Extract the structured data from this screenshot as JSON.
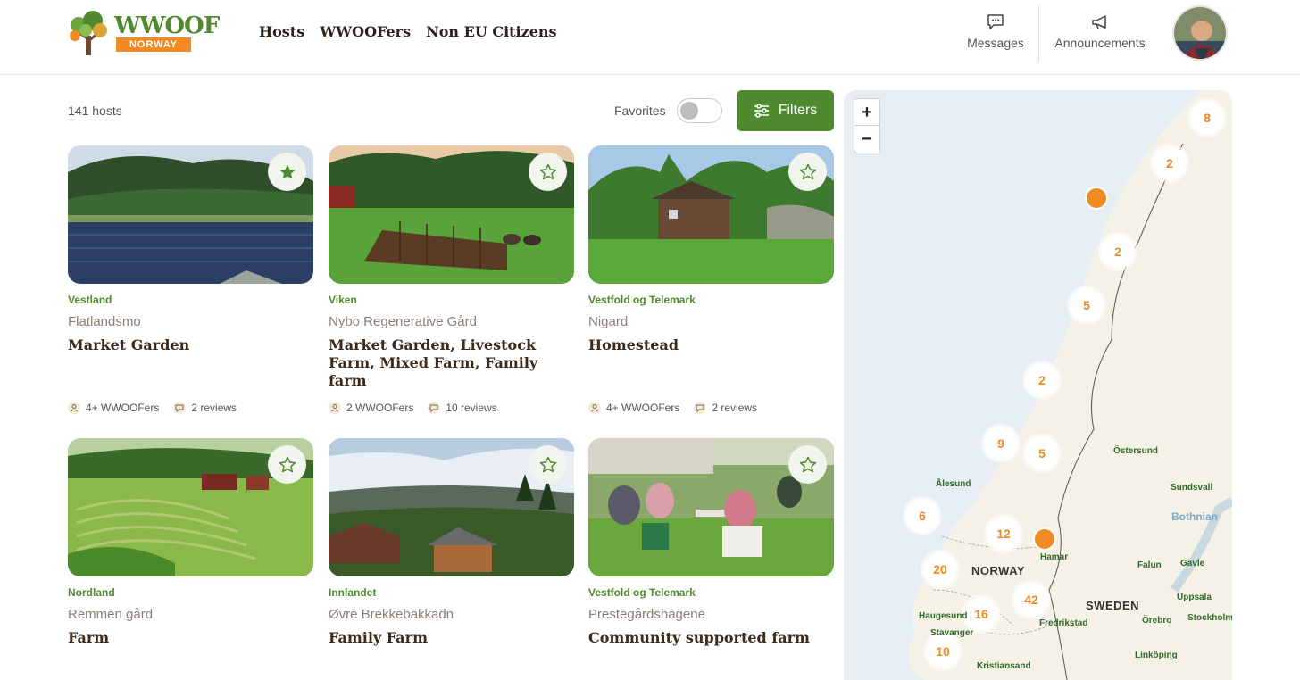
{
  "header": {
    "logo_word": "WWOOF",
    "logo_sub": "NORWAY",
    "nav": [
      "Hosts",
      "WWOOFers",
      "Non EU Citizens"
    ],
    "messages_label": "Messages",
    "announcements_label": "Announcements"
  },
  "toolbar": {
    "hosts_count": "141 hosts",
    "favorites_label": "Favorites",
    "favorites_enabled": false,
    "filters_label": "Filters"
  },
  "cards": [
    {
      "region": "Vestland",
      "name": "Flatlandsmo",
      "type": "Market Garden",
      "wwoofers": "4+ WWOOFers",
      "reviews": "2 reviews",
      "favorited": true
    },
    {
      "region": "Viken",
      "name": "Nybo Regenerative Gård",
      "type": "Market Garden, Livestock Farm, Mixed Farm, Family farm",
      "wwoofers": "2 WWOOFers",
      "reviews": "10 reviews",
      "favorited": false
    },
    {
      "region": "Vestfold og Telemark",
      "name": "Nigard",
      "type": "Homestead",
      "wwoofers": "4+ WWOOFers",
      "reviews": "2 reviews",
      "favorited": false
    },
    {
      "region": "Nordland",
      "name": "Remmen gård",
      "type": "Farm",
      "favorited": false
    },
    {
      "region": "Innlandet",
      "name": "Øvre Brekkebakkadn",
      "type": "Family Farm",
      "favorited": false
    },
    {
      "region": "Vestfold og Telemark",
      "name": "Prestegårdshagene",
      "type": "Community supported farm",
      "favorited": false
    }
  ],
  "map": {
    "zoom_in": "+",
    "zoom_out": "−",
    "clusters": [
      "8",
      "2",
      "2",
      "5",
      "2",
      "9",
      "5",
      "6",
      "12",
      "20",
      "42",
      "16",
      "10"
    ],
    "cities": [
      "Östersund",
      "Sundsvall",
      "Ålesund",
      "Hamar",
      "Falun",
      "Gävle",
      "Uppsala",
      "Haugesund",
      "Fredrikstad",
      "Örebro",
      "Stockholm",
      "Stavanger",
      "Linköping",
      "Kristiansand"
    ],
    "countries": [
      "NORWAY",
      "SWEDEN"
    ],
    "sea": "Bothnian"
  },
  "colors": {
    "brand_green": "#4f8a2e",
    "brand_orange": "#f08a24"
  }
}
